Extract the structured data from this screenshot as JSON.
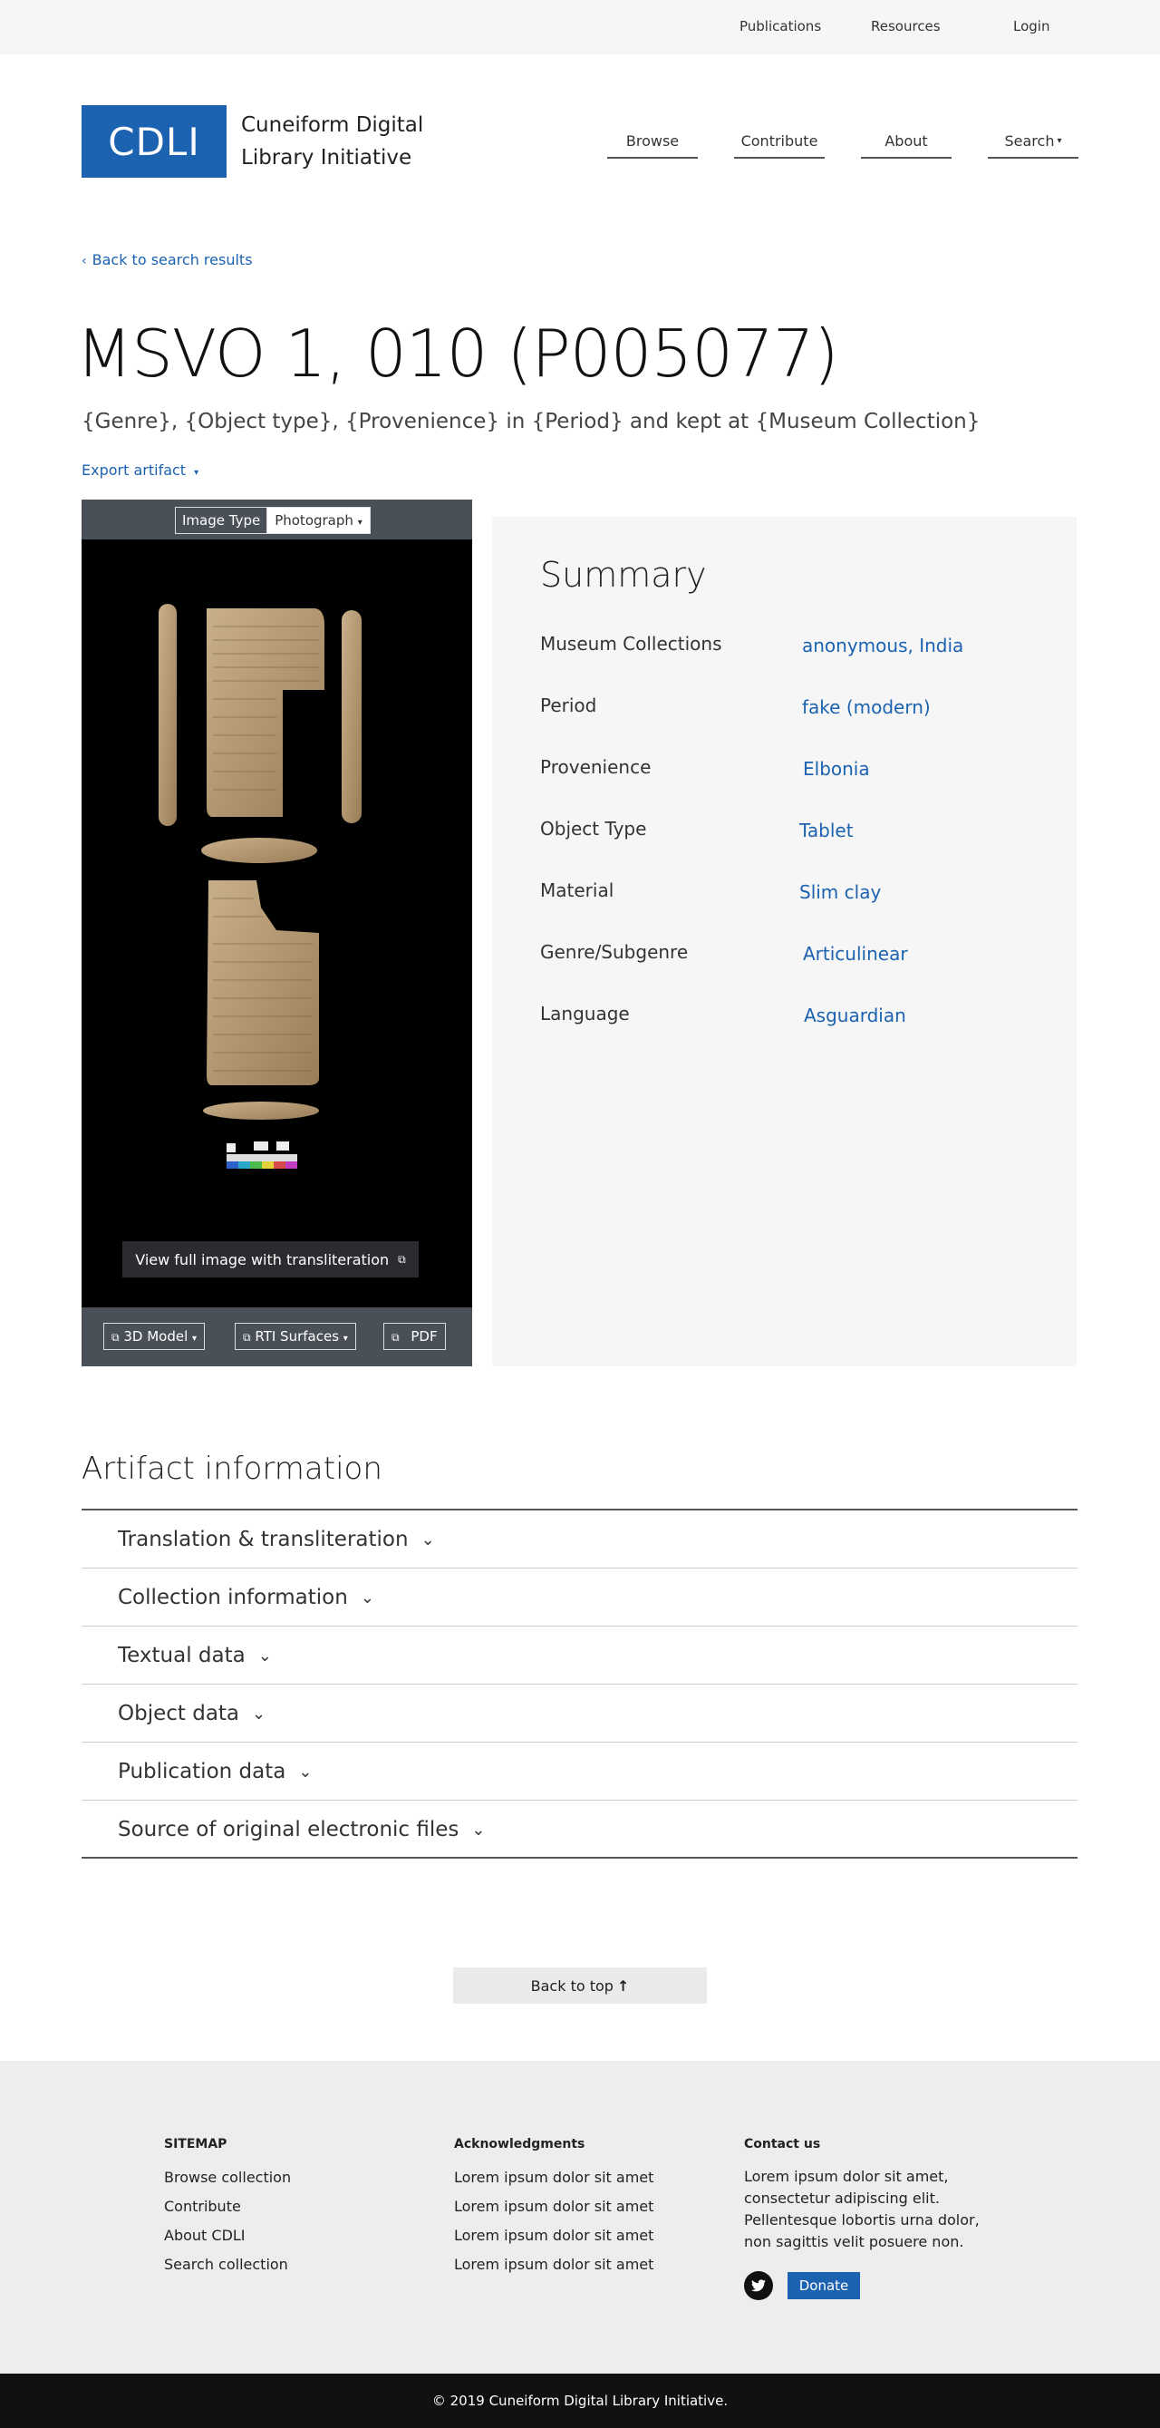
{
  "topbar": {
    "links": [
      "Publications",
      "Resources",
      "Login"
    ]
  },
  "header": {
    "logo": "CDLI",
    "site_name": "Cuneiform Digital Library Initiative",
    "nav": [
      "Browse",
      "Contribute",
      "About",
      "Search"
    ]
  },
  "page": {
    "back_link": "Back to search results",
    "title": "MSVO 1, 010 (P005077)",
    "subtitle": "{Genre}, {Object type}, {Provenience} in {Period} and kept at {Museum Collection}",
    "export": "Export artifact"
  },
  "image_panel": {
    "type_label": "Image Type",
    "type_value": "Photograph",
    "view_full": "View full image with transliteration",
    "buttons": [
      "3D Model",
      "RTI Surfaces",
      "PDF"
    ]
  },
  "summary": {
    "title": "Summary",
    "rows": [
      {
        "label": "Museum Collections",
        "value": "anonymous, India"
      },
      {
        "label": "Period",
        "value": "fake (modern)"
      },
      {
        "label": "Provenience",
        "value": "Elbonia"
      },
      {
        "label": "Object Type",
        "value": "Tablet"
      },
      {
        "label": "Material",
        "value": "Slim clay"
      },
      {
        "label": "Genre/Subgenre",
        "value": "Articulinear"
      },
      {
        "label": "Language",
        "value": "Asguardian"
      }
    ]
  },
  "artifact_info": {
    "title": "Artifact information",
    "sections": [
      "Translation & transliteration",
      "Collection information",
      "Textual data",
      "Object data",
      "Publication data",
      "Source of original electronic files"
    ]
  },
  "back_to_top": "Back to top",
  "footer": {
    "sitemap": {
      "title": "SITEMAP",
      "links": [
        "Browse collection",
        "Contribute",
        "About CDLI",
        "Search collection"
      ]
    },
    "acknowledgments": {
      "title": "Acknowledgments",
      "links": [
        "Lorem ipsum dolor sit amet",
        "Lorem ipsum dolor sit amet",
        "Lorem ipsum dolor sit amet",
        "Lorem ipsum dolor sit amet"
      ]
    },
    "contact": {
      "title": "Contact us",
      "text": "Lorem ipsum dolor sit amet, consectetur adipiscing elit. Pellentesque lobortis urna dolor, non sagittis velit posuere non.",
      "donate": "Donate"
    },
    "copyright": "© 2019 Cuneiform Digital Library Initiative."
  },
  "colors": {
    "brand_blue": "#1b62b0",
    "panel_gray": "#4a5058",
    "summary_bg": "#f6f6f6",
    "footer_bg": "#ededed"
  }
}
